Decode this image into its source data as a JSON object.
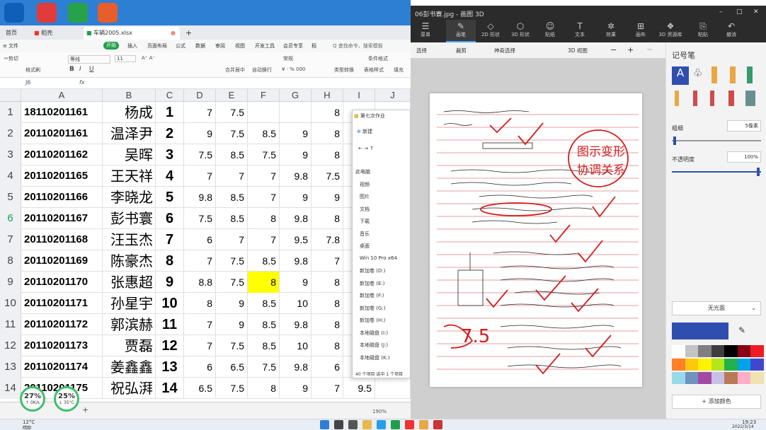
{
  "launcher": {
    "icon_colors": [
      "#0f5fb8",
      "#e13b3b",
      "#27a24b",
      "#e85d2a"
    ]
  },
  "wps": {
    "tabs": [
      {
        "label": "首页"
      },
      {
        "label": "稻壳"
      },
      {
        "label": "车辆2005.xlsx"
      }
    ],
    "tab_dot": "●",
    "tab_add": "+",
    "menu": [
      "≡ 文件",
      "开始",
      "插入",
      "页面布局",
      "公式",
      "数据",
      "审阅",
      "视图",
      "开发工具",
      "会员专享",
      "稻",
      "Q 查找命令、搜索模板"
    ],
    "ribbon": {
      "row1": [
        "✂剪切",
        "等线",
        "11",
        "A⁺ A⁻",
        "常规",
        "条件格式"
      ],
      "row2": [
        "格式刷",
        "B",
        "I",
        "U",
        "合并居中",
        "自动换行",
        "¥ · % 000",
        "类型转换",
        "表格样式",
        "填充"
      ]
    },
    "namebox": "J6",
    "fx": "fx",
    "columns": [
      "A",
      "B",
      "C",
      "D",
      "E",
      "F",
      "G",
      "H",
      "I",
      "J"
    ],
    "rows": [
      {
        "n": "1",
        "a": "18110201161",
        "b": "杨成",
        "c": "1",
        "d": "7",
        "e": "7.5",
        "f": "",
        "g": "",
        "h": "8",
        "i": ""
      },
      {
        "n": "2",
        "a": "20110201161",
        "b": "温泽尹",
        "c": "2",
        "d": "9",
        "e": "7.5",
        "f": "8.5",
        "g": "9",
        "h": "8",
        "i": ""
      },
      {
        "n": "3",
        "a": "20110201162",
        "b": "吴晖",
        "c": "3",
        "d": "7.5",
        "e": "8.5",
        "f": "7.5",
        "g": "9",
        "h": "8",
        "i": ""
      },
      {
        "n": "4",
        "a": "20110201165",
        "b": "王天祥",
        "c": "4",
        "d": "7",
        "e": "7",
        "f": "7",
        "g": "9.8",
        "h": "7.5",
        "i": ""
      },
      {
        "n": "5",
        "a": "20110201166",
        "b": "李晓龙",
        "c": "5",
        "d": "9.8",
        "e": "8.5",
        "f": "7",
        "g": "9",
        "h": "9",
        "i": ""
      },
      {
        "n": "6",
        "a": "20110201167",
        "b": "彭书寰",
        "c": "6",
        "d": "7.5",
        "e": "8.5",
        "f": "8",
        "g": "9.8",
        "h": "8",
        "i": ""
      },
      {
        "n": "7",
        "a": "20110201168",
        "b": "汪玉杰",
        "c": "7",
        "d": "6",
        "e": "7",
        "f": "7",
        "g": "9.5",
        "h": "7.8",
        "i": ""
      },
      {
        "n": "8",
        "a": "20110201169",
        "b": "陈豪杰",
        "c": "8",
        "d": "7",
        "e": "7.5",
        "f": "8.5",
        "g": "9.8",
        "h": "7",
        "i": ""
      },
      {
        "n": "9",
        "a": "20110201170",
        "b": "张惠超",
        "c": "9",
        "d": "8.8",
        "e": "7.5",
        "f": "8",
        "g": "9",
        "h": "8",
        "i": ""
      },
      {
        "n": "10",
        "a": "20110201171",
        "b": "孙星宇",
        "c": "10",
        "d": "8",
        "e": "9",
        "f": "8.5",
        "g": "10",
        "h": "8",
        "i": ""
      },
      {
        "n": "11",
        "a": "20110201172",
        "b": "郭滨赫",
        "c": "11",
        "d": "7",
        "e": "9",
        "f": "8.5",
        "g": "9.8",
        "h": "8",
        "i": ""
      },
      {
        "n": "12",
        "a": "20110201173",
        "b": "贾磊",
        "c": "12",
        "d": "7",
        "e": "7.5",
        "f": "8.5",
        "g": "10",
        "h": "8",
        "i": ""
      },
      {
        "n": "13",
        "a": "20110201174",
        "b": "姜鑫鑫",
        "c": "13",
        "d": "6",
        "e": "6.5",
        "f": "7.5",
        "g": "9.8",
        "h": "6",
        "i": ""
      },
      {
        "n": "14",
        "a": "20110201175",
        "b": "祝弘湃",
        "c": "14",
        "d": "6.5",
        "e": "7.5",
        "f": "8",
        "g": "9",
        "h": "7",
        "i": "9.5"
      }
    ],
    "highlight_color": "#ffff00",
    "badges": [
      {
        "pct": "27%",
        "sub": "↑ 0K/s"
      },
      {
        "pct": "25%",
        "sub": "↓ 35°C"
      }
    ],
    "sheet_add": "+",
    "zoom": "190%"
  },
  "explorer": {
    "title": "第七次作业",
    "new_label": "新建",
    "items": [
      "此电脑",
      "视频",
      "图片",
      "文档",
      "下载",
      "音乐",
      "桌面",
      "Win 10 Pro x64",
      "新加卷 (D:)",
      "新加卷 (E:)",
      "新加卷 (F:)",
      "新加卷 (G:)",
      "新加卷 (H:)",
      "本地磁盘 (I:)",
      "本地磁盘 (J:)",
      "本地磁盘 (K:)"
    ],
    "status": "40 个项目   选中 1 个项目"
  },
  "paint3d": {
    "title": "06彭书寰.jpg - 画图 3D",
    "window_buttons": [
      "–",
      "□",
      "✕"
    ],
    "tools": [
      {
        "label": "菜单",
        "glyph": "☰"
      },
      {
        "label": "画笔",
        "glyph": "✎"
      },
      {
        "label": "2D 形状",
        "glyph": "◇"
      },
      {
        "label": "3D 形状",
        "glyph": "⬡"
      },
      {
        "label": "贴纸",
        "glyph": "☺"
      },
      {
        "label": "文本",
        "glyph": "T"
      },
      {
        "label": "效果",
        "glyph": "✲"
      },
      {
        "label": "画布",
        "glyph": "⊞"
      },
      {
        "label": "3D 资源库",
        "glyph": "❖"
      },
      {
        "label": "粘贴",
        "glyph": "⎘"
      },
      {
        "label": "撤消",
        "glyph": "↶"
      }
    ],
    "subbar": [
      "选择",
      "裁剪",
      "神奇选择",
      "3D 视图",
      "−",
      "+",
      "···"
    ],
    "side": {
      "title": "记号笔",
      "thickness_label": "粗细",
      "thickness_value": "5像素",
      "opacity_label": "不透明度",
      "opacity_value": "100%",
      "finish": "无光面",
      "current_color": "#2f4fb0",
      "add_color": "+ 添加颜色",
      "swatches": [
        "#ffffff",
        "#c3c3c3",
        "#7f7f7f",
        "#3d3d3d",
        "#000000",
        "#880015",
        "#ed1c24",
        "#ff7f27",
        "#ffc90e",
        "#fff200",
        "#b5e61d",
        "#22b14c",
        "#00a2e8",
        "#3f48cc",
        "#99d9ea",
        "#7092be",
        "#a349a4",
        "#c8bfe7",
        "#b97a57",
        "#ffaec9",
        "#efe4b0"
      ]
    },
    "annotation": {
      "circle_text_1": "图示变形",
      "circle_text_2": "协调关系",
      "score": "7.5"
    }
  },
  "taskbar": {
    "weather_temp": "12°C",
    "weather_desc": "晴朗",
    "time": "19:23",
    "date": "2022/3/14"
  }
}
